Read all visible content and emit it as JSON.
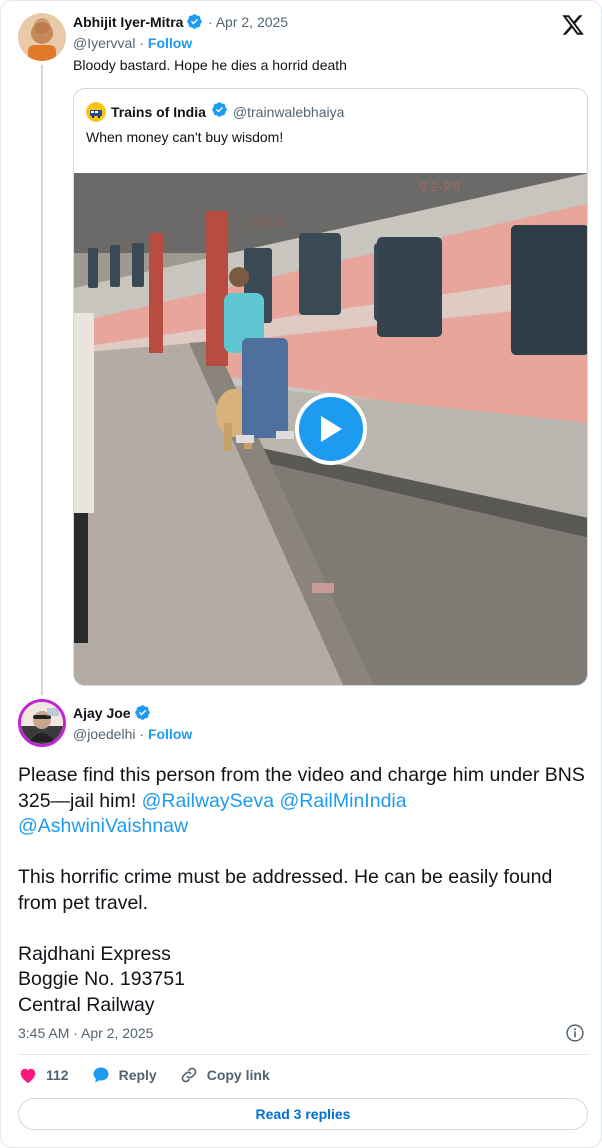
{
  "parent_tweet": {
    "author_name": "Abhijit Iyer-Mitra",
    "handle": "@Iyervval",
    "date": "Apr 2, 2025",
    "follow_label": "Follow",
    "text": "Bloody bastard. Hope he dies a horrid death"
  },
  "quoted_tweet": {
    "author_name": "Trains of India",
    "handle": "@trainwalebhaiya",
    "text": "When money can't buy wisdom!",
    "coach_number": "193751",
    "coach_hindi": "ए 2-प्रथ"
  },
  "main_tweet": {
    "author_name": "Ajay Joe",
    "handle": "@joedelhi",
    "follow_label": "Follow",
    "text_part1": "Please find this person from the video and charge him under BNS 325—jail him! ",
    "mention1": "@RailwaySeva",
    "mention2": "@RailMinIndia",
    "mention3": "@AshwiniVaishnaw",
    "text_part2": "This horrific crime must be addressed. He can be easily found from pet travel.\n\nRajdhani Express\nBoggie No. 193751\nCentral Railway",
    "timestamp": "3:45 AM · Apr 2, 2025"
  },
  "actions": {
    "like_count": "112",
    "reply_label": "Reply",
    "copy_link_label": "Copy link",
    "read_replies_label": "Read 3 replies"
  },
  "colors": {
    "accent": "#1d9bf0",
    "like": "#f91880",
    "text": "#0f1419",
    "muted": "#536471"
  }
}
